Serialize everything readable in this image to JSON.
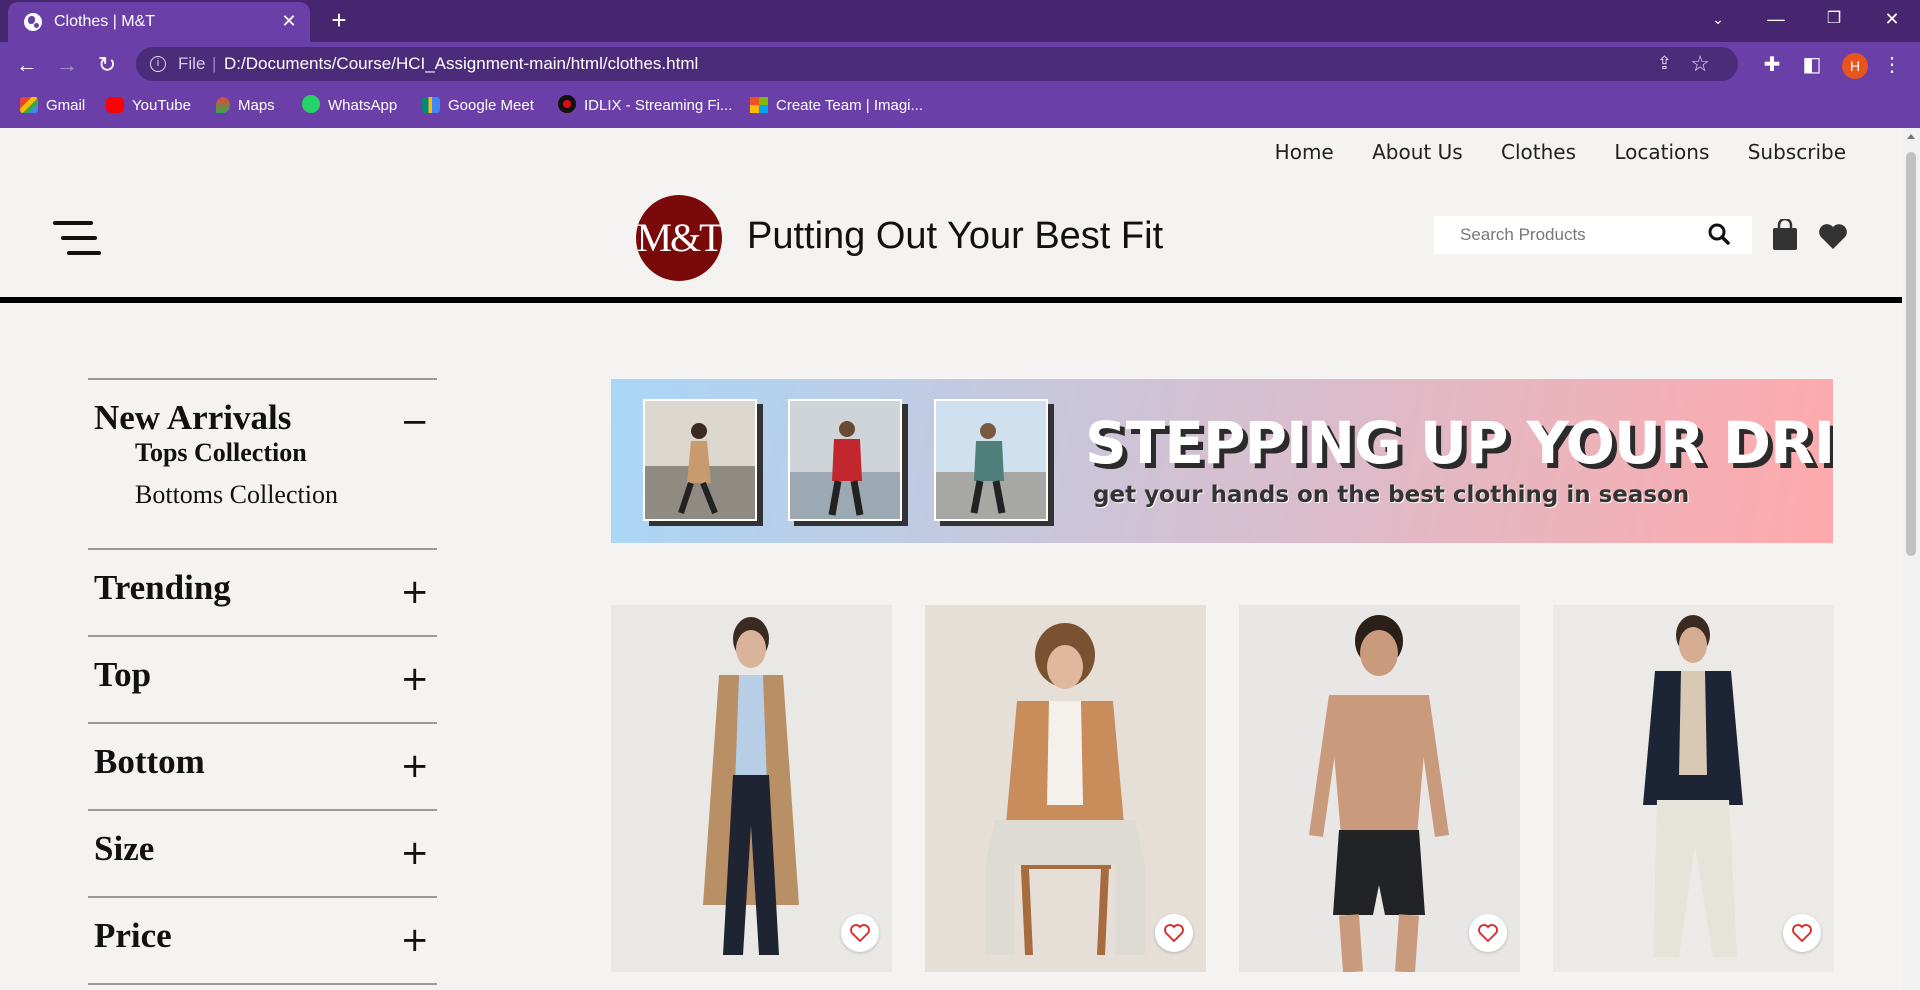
{
  "browser": {
    "tab_title": "Clothes | M&T",
    "scheme": "File",
    "url": "D:/Documents/Course/HCI_Assignment-main/html/clothes.html",
    "profile_initial": "H",
    "accent": "#6a3fa8",
    "tabstrip_color": "#48256f",
    "bookmarks": [
      {
        "label": "Gmail",
        "icon": "gmail-icon"
      },
      {
        "label": "YouTube",
        "icon": "youtube-icon"
      },
      {
        "label": "Maps",
        "icon": "maps-icon"
      },
      {
        "label": "WhatsApp",
        "icon": "whatsapp-icon"
      },
      {
        "label": "Google Meet",
        "icon": "meet-icon"
      },
      {
        "label": "IDLIX - Streaming Fi...",
        "icon": "idlix-icon"
      },
      {
        "label": "Create Team | Imagi...",
        "icon": "microsoft-icon"
      }
    ]
  },
  "site": {
    "nav": [
      "Home",
      "About Us",
      "Clothes",
      "Locations",
      "Subscribe"
    ],
    "logo_text": "M&T",
    "tagline": "Putting Out Your Best Fit",
    "search_placeholder": "Search Products",
    "brand_color": "#7a0a0a"
  },
  "sidebar": {
    "sections": [
      {
        "title": "New Arrivals",
        "toggle": "−",
        "items": [
          {
            "label": "Tops Collection",
            "active": true
          },
          {
            "label": "Bottoms Collection",
            "active": false
          }
        ]
      },
      {
        "title": "Trending",
        "toggle": "+"
      },
      {
        "title": "Top",
        "toggle": "+"
      },
      {
        "title": "Bottom",
        "toggle": "+"
      },
      {
        "title": "Size",
        "toggle": "+"
      },
      {
        "title": "Price",
        "toggle": "+"
      }
    ]
  },
  "banner": {
    "headline": "STEPPING UP YOUR DRIP",
    "subline": "get your hands on the best clothing in season"
  },
  "products": [
    {
      "name": "camel-trench-coat",
      "fav_icon": "heart-outline-icon"
    },
    {
      "name": "tan-blazer",
      "fav_icon": "heart-outline-icon"
    },
    {
      "name": "black-swim-shorts",
      "fav_icon": "heart-outline-icon"
    },
    {
      "name": "navy-overshirt",
      "fav_icon": "heart-outline-icon"
    }
  ]
}
